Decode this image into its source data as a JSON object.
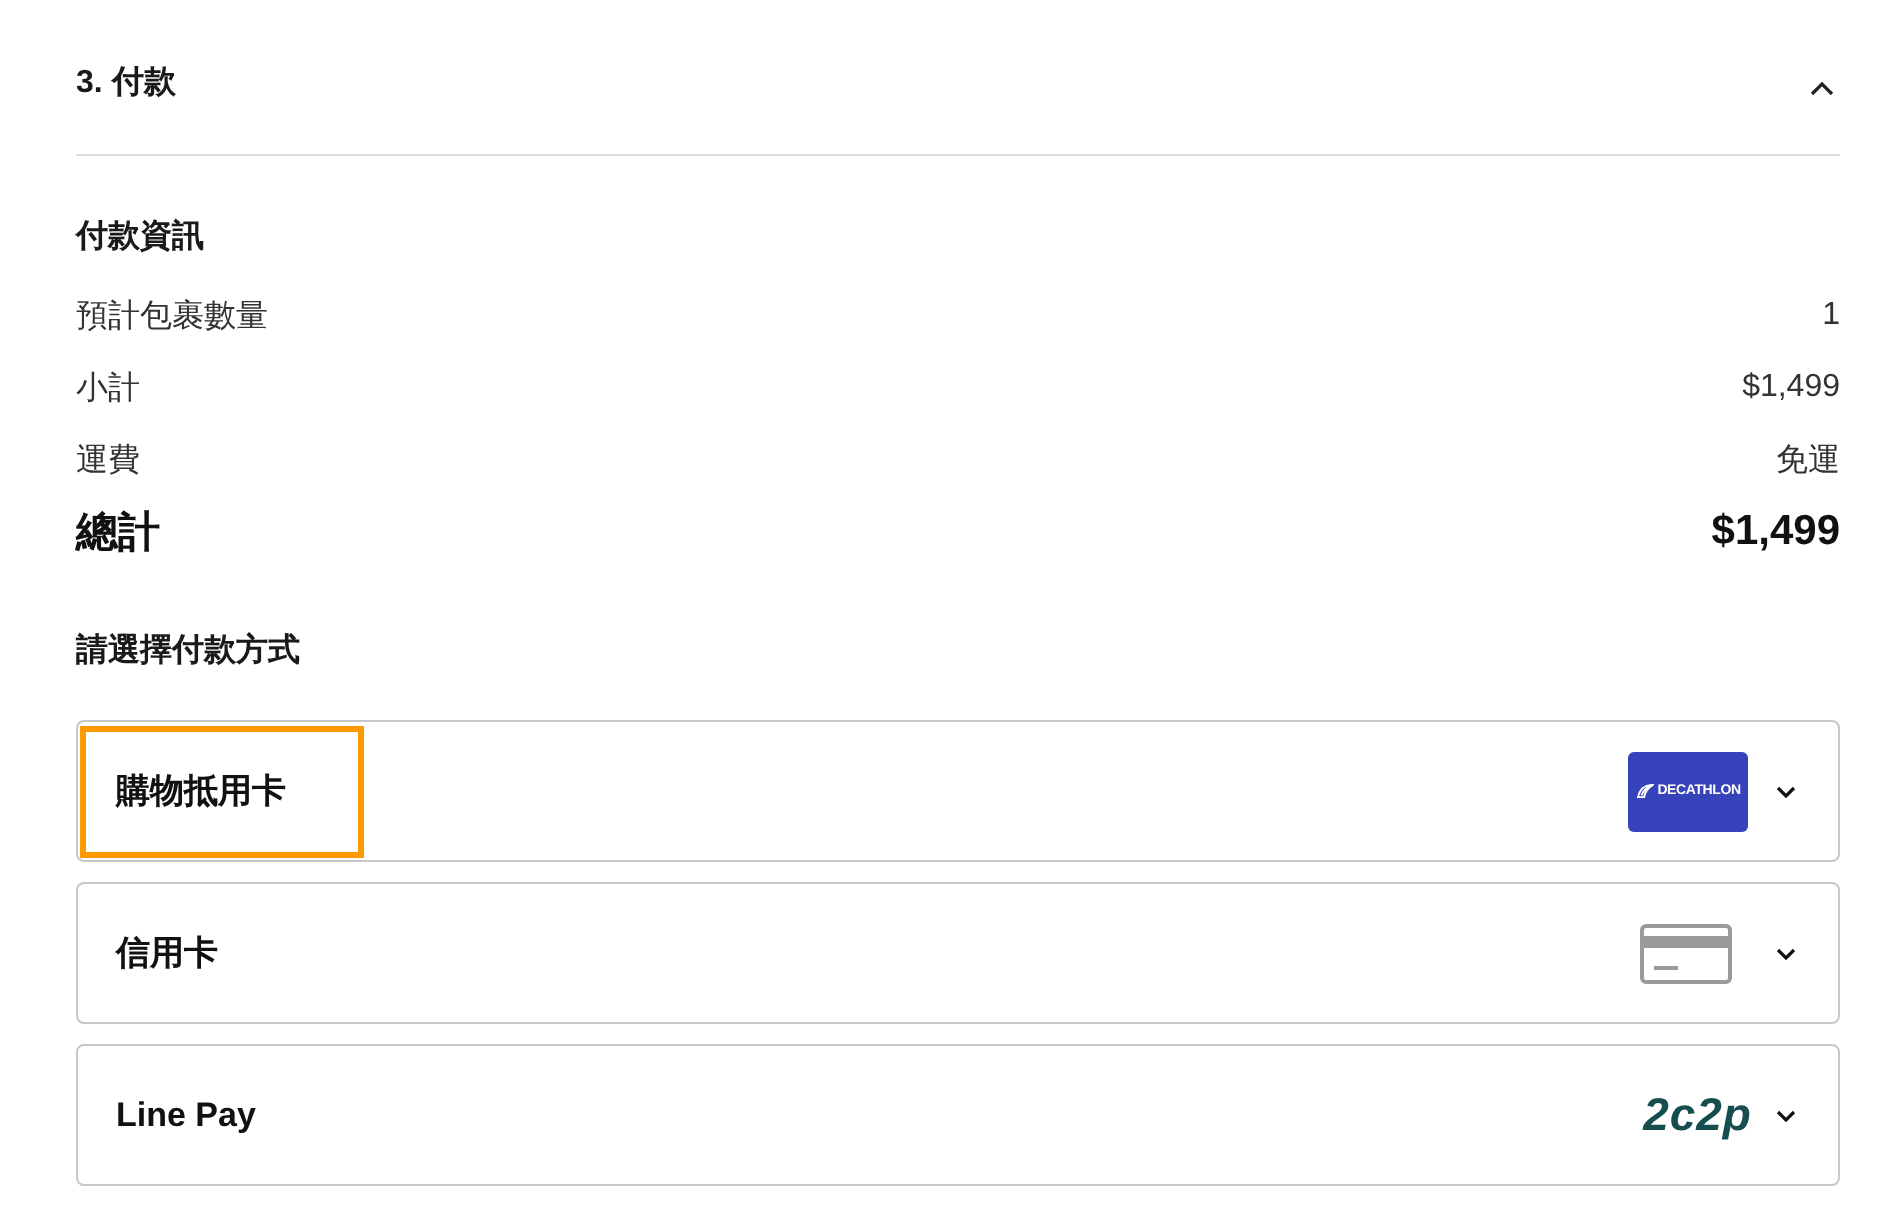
{
  "section": {
    "title": "3. 付款",
    "expanded": true
  },
  "summary": {
    "heading": "付款資訊",
    "rows": [
      {
        "label": "預計包裹數量",
        "value": "1"
      },
      {
        "label": "小計",
        "value": "$1,499"
      },
      {
        "label": "運費",
        "value": "免運"
      }
    ],
    "total": {
      "label": "總計",
      "value": "$1,499"
    }
  },
  "payment_methods": {
    "heading": "請選擇付款方式",
    "options": [
      {
        "label": "購物抵用卡",
        "kind": "voucher",
        "logo_text": "DECATHLON",
        "highlighted": true,
        "expanded": false
      },
      {
        "label": "信用卡",
        "kind": "card",
        "highlighted": false,
        "expanded": false
      },
      {
        "label": "Line Pay",
        "kind": "wallet",
        "logo_text": "2c2p",
        "highlighted": false,
        "expanded": false
      }
    ]
  }
}
